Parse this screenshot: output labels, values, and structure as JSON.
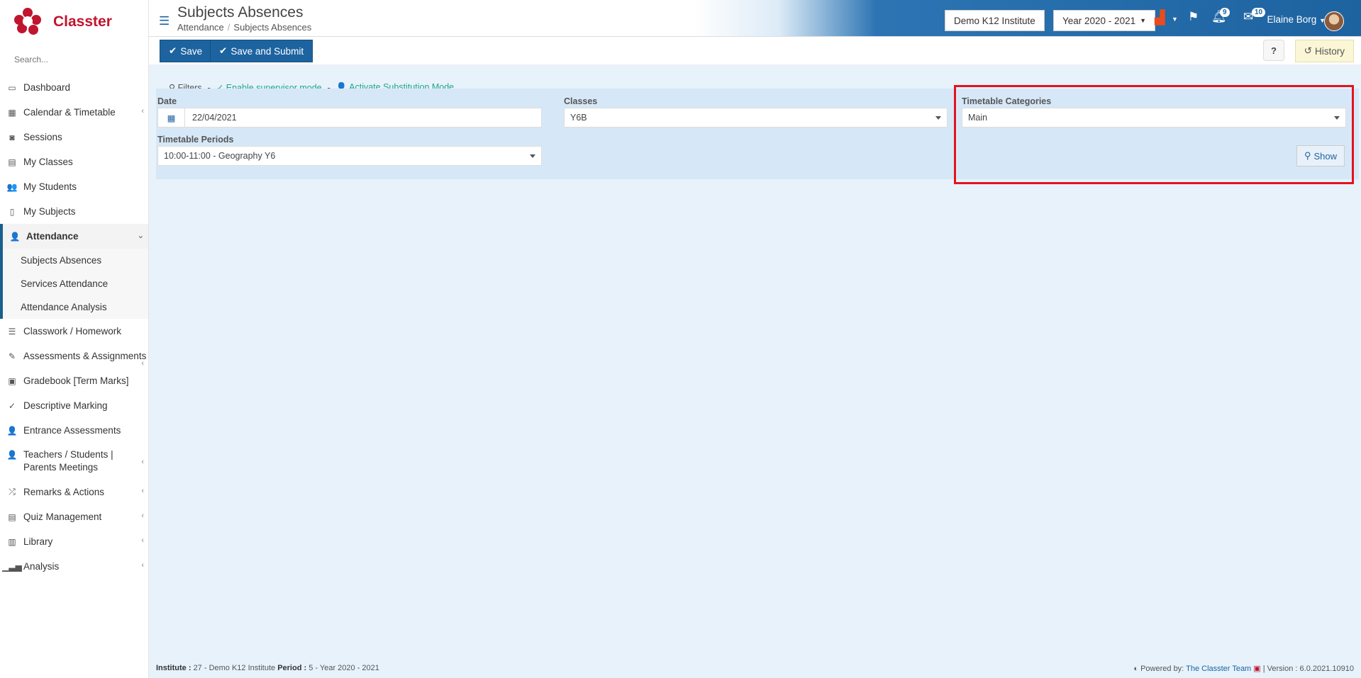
{
  "app": {
    "name": "Classter"
  },
  "search": {
    "placeholder": "Search..."
  },
  "sidebar": {
    "items": [
      {
        "label": "Dashboard",
        "icon": "laptop-icon"
      },
      {
        "label": "Calendar & Timetable",
        "icon": "calendar-icon"
      },
      {
        "label": "Sessions",
        "icon": "sessions-icon"
      },
      {
        "label": "My Classes",
        "icon": "classes-icon"
      },
      {
        "label": "My Students",
        "icon": "students-icon"
      },
      {
        "label": "My Subjects",
        "icon": "book-icon"
      },
      {
        "label": "Attendance",
        "icon": "user-x-icon"
      },
      {
        "label": "Classwork / Homework",
        "icon": "checklist-icon"
      },
      {
        "label": "Assessments & Assignments",
        "icon": "edit-icon"
      },
      {
        "label": "Gradebook [Term Marks]",
        "icon": "gradebook-icon"
      },
      {
        "label": "Descriptive Marking",
        "icon": "marking-icon"
      },
      {
        "label": "Entrance Assessments",
        "icon": "user-edit-icon"
      },
      {
        "label": "Teachers / Students | Parents Meetings",
        "icon": "meeting-icon"
      },
      {
        "label": "Remarks & Actions",
        "icon": "remarks-icon"
      },
      {
        "label": "Quiz Management",
        "icon": "quiz-icon"
      },
      {
        "label": "Library",
        "icon": "library-icon"
      },
      {
        "label": "Analysis",
        "icon": "chart-icon"
      }
    ],
    "attendance_sub": [
      "Subjects Absences",
      "Services Attendance",
      "Attendance Analysis"
    ]
  },
  "header": {
    "title": "Subjects Absences",
    "breadcrumb": [
      "Attendance",
      "Subjects Absences"
    ],
    "institute": "Demo K12 Institute",
    "year": "Year 2020 - 2021",
    "notifications": "9",
    "messages": "10",
    "user": "Elaine Borg"
  },
  "toolbar": {
    "save": "Save",
    "save_submit": "Save and Submit",
    "help": "?",
    "history": "History"
  },
  "filters": {
    "filters_label": "Filters",
    "supervisor": "Enable supervisor mode",
    "substitution": "Activate Substitution Mode",
    "date_label": "Date",
    "date_value": "22/04/2021",
    "classes_label": "Classes",
    "classes_value": "Y6B",
    "categories_label": "Timetable Categories",
    "categories_value": "Main",
    "periods_label": "Timetable Periods",
    "periods_value": "10:00-11:00 - Geography Y6",
    "show": "Show"
  },
  "footer": {
    "institute_label": "Institute :",
    "institute_value": "27 - Demo K12 Institute",
    "period_label": "Period :",
    "period_value": "5 - Year 2020 - 2021",
    "powered": "Powered by:",
    "team": "The Classter Team",
    "version": "| Version : 6.0.2021.10910"
  },
  "colors": {
    "brand": "#c0152f",
    "primary": "#1d63a0",
    "highlight": "#e3131f"
  }
}
